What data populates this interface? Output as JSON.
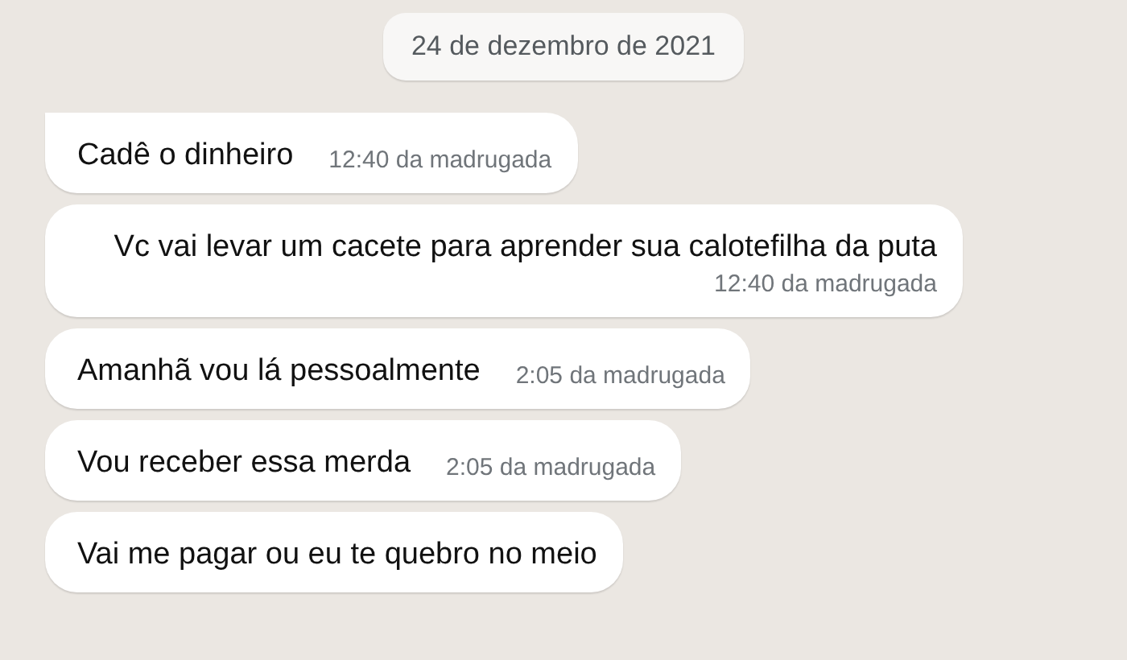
{
  "date_chip": "24 de dezembro de 2021",
  "messages": [
    {
      "text": "Cadê o dinheiro",
      "time": "12:40 da madrugada",
      "tail": true
    },
    {
      "text": "Vc vai levar um cacete para aprender sua calotefilha da puta",
      "time": "12:40 da madrugada",
      "tail": false
    },
    {
      "text": "Amanhã vou lá pessoalmente",
      "time": "2:05 da madrugada",
      "tail": false
    },
    {
      "text": "Vou receber essa merda",
      "time": "2:05 da madrugada",
      "tail": false
    },
    {
      "text": "Vai me pagar ou eu te quebro no meio",
      "tail": false
    }
  ]
}
